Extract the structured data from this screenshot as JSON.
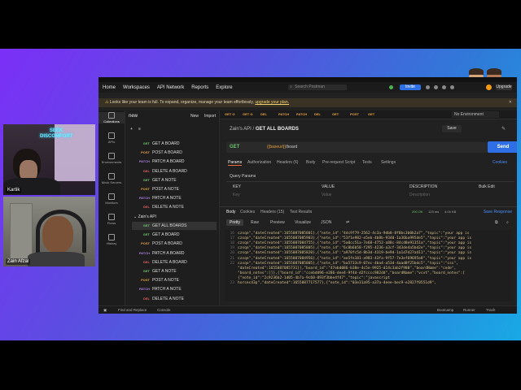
{
  "webcams": [
    {
      "name": "Kartik",
      "sign": "SEEK DISCOMFORT"
    },
    {
      "name": "Zain Afzal"
    }
  ],
  "topnav": {
    "items": [
      "Home",
      "Workspaces",
      "API Network",
      "Reports",
      "Explore"
    ],
    "search_placeholder": "Search Postman",
    "invite_label": "Invite",
    "upgrade_label": "Upgrade"
  },
  "banner": {
    "text": "Looks like your team is full. To expand, organize, manage your team effortlessly,",
    "link": "upgrade your plan."
  },
  "leftrail": [
    "Collections",
    "APIs",
    "Environments",
    "Mock Servers",
    "Monitors",
    "Flows",
    "History"
  ],
  "sidebar": {
    "workspace": "new",
    "new_label": "New",
    "import_label": "Import",
    "folder_label": "Zain's API",
    "requests_top": [
      {
        "method": "GET",
        "name": "GET A BOARD"
      },
      {
        "method": "POST",
        "name": "POST A BOARD"
      },
      {
        "method": "PATCH",
        "name": "PATCH A BOARD"
      },
      {
        "method": "DEL",
        "name": "DELETE A BOARD"
      },
      {
        "method": "GET",
        "name": "GET A NOTE"
      },
      {
        "method": "POST",
        "name": "POST A NOTE"
      },
      {
        "method": "PATCH",
        "name": "PATCH A NOTE"
      },
      {
        "method": "DEL",
        "name": "DELETE A NOTE"
      }
    ],
    "requests_folder": [
      {
        "method": "GET",
        "name": "GET ALL BOARDS"
      },
      {
        "method": "GET",
        "name": "GET A BOARD"
      },
      {
        "method": "POST",
        "name": "POST A BOARD"
      },
      {
        "method": "PATCH",
        "name": "PATCH A BOARD"
      },
      {
        "method": "DEL",
        "name": "DELETE A BOARD"
      },
      {
        "method": "GET",
        "name": "GET A NOTE"
      },
      {
        "method": "POST",
        "name": "POST A NOTE"
      },
      {
        "method": "PATCH",
        "name": "PATCH A NOTE"
      },
      {
        "method": "DEL",
        "name": "DELETE A NOTE"
      }
    ]
  },
  "tabs": [
    "GET G",
    "GET G",
    "DEL",
    "PATCH",
    "PATCH",
    "DEL",
    "GET",
    "POST",
    "GET"
  ],
  "environment": "No Environment",
  "request": {
    "breadcrumb_parent": "Zain's API",
    "breadcrumb_name": "GET ALL BOARDS",
    "save_label": "Save",
    "method": "GET",
    "url_var": "{{baseurl}}",
    "url_path": "/board",
    "send_label": "Send",
    "tabs": [
      "Params",
      "Authorization",
      "Headers (6)",
      "Body",
      "Pre-request Script",
      "Tests",
      "Settings"
    ],
    "cookies_label": "Cookies",
    "query_params_label": "Query Params",
    "param_headers": [
      "KEY",
      "VALUE",
      "DESCRIPTION",
      "Bulk Edit"
    ],
    "param_placeholders": [
      "Key",
      "Value",
      "Description"
    ]
  },
  "response": {
    "tabs": [
      "Body",
      "Cookies",
      "Headers (15)",
      "Test Results"
    ],
    "status": "200 OK",
    "time": "123 ms",
    "size": "4.04 KB",
    "save_label": "Save Response",
    "formats": [
      "Pretty",
      "Raw",
      "Preview",
      "Visualize",
      "JSON"
    ],
    "code_lines": [
      {
        "n": "16",
        "text": "czsqo\",\"dateCreated\":1655087085801},{\"note_id\":\"4dc9f79-2562-4c3a-9db8-8f0bc3b0b2a7\",\"topic\":\"your app is"
      },
      {
        "n": "17",
        "text": "czsqo\",\"dateCreated\":1655087085903},{\"note_id\":\"53f1e982-e5eb-4b8b-9340-1a36ba995de5\",\"topic\":\"your app is"
      },
      {
        "n": "18",
        "text": "czsqo\",\"dateCreated\":1655087084755},{\"note_id\":\"5a0cc51a-7e68-4752-a88c-84cd8e91351a\",\"topic\":\"your app is"
      },
      {
        "n": "19",
        "text": "czsqo\",\"dateCreated\":1655087085805},{\"note_id\":\"6c8b6b58-f295-4236-a3cf-343de4a5bd2e\",\"topic\":\"your app is"
      },
      {
        "n": "20",
        "text": "czsqo\",\"dateCreated\":1655087085820},{\"note_id\":\"a970fc5d-8b3d-4319-be9d-1a1d7d27ad11\",\"topic\":\"your app is"
      },
      {
        "n": "21",
        "text": "czsqo\",\"dateCreated\":1655087084956},{\"note_id\":\"ae5fe181-a983-43fa-9f57-7e3ef69695e8\",\"topic\":\"your app is"
      },
      {
        "n": "22",
        "text": "czsqo\",\"dateCreated\":1655087085805},{\"note_id\":\"ba5733c9-07ec-4ba4-a53d-4aad8f25bdc5\",\"topic\":\"css\","
      },
      {
        "n": "",
        "text": "\"dateCreated\":1655087085731}],\"board_id\":\"47ebd086-b38e-4c5e-9925-d14c3ab2f988\",\"boardName\":\"code\","
      },
      {
        "n": "",
        "text": "\"board_notes\":[]},{\"board_id\":\"ccebdd96-e286-dee4-9f4d-d2fcccc982dd\",\"boardName\":\"vcvt\",\"board_notes\":["
      },
      {
        "n": "",
        "text": "{\"note_id\":\"2c9236b2-1d05-4b7a-9c60-893f3bbe4f47\",\"topic\":\"javascript"
      },
      {
        "n": "23",
        "text": "horsec43p\",\"dateCreated\":1655087717577},{\"note_id\":\"03e31a95-a37a-4eee-bec9-e2827f0551d9\","
      }
    ]
  },
  "footer": [
    "Find and Replace",
    "Console",
    "Bootcamp",
    "Runner",
    "Trash"
  ]
}
